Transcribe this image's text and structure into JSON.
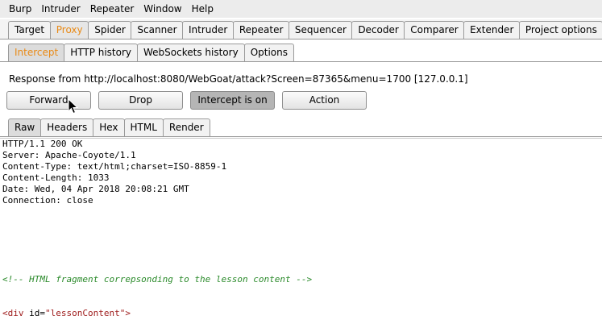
{
  "menubar": [
    "Burp",
    "Intruder",
    "Repeater",
    "Window",
    "Help"
  ],
  "main_tabs": [
    "Target",
    "Proxy",
    "Spider",
    "Scanner",
    "Intruder",
    "Repeater",
    "Sequencer",
    "Decoder",
    "Comparer",
    "Extender",
    "Project options"
  ],
  "main_active": "Proxy",
  "sub_tabs": [
    "Intercept",
    "HTTP history",
    "WebSockets history",
    "Options"
  ],
  "sub_active": "Intercept",
  "response_info": "Response from http://localhost:8080/WebGoat/attack?Screen=87365&menu=1700  [127.0.0.1]",
  "buttons": {
    "forward": "Forward",
    "drop": "Drop",
    "intercept": "Intercept is on",
    "action": "Action"
  },
  "view_tabs": [
    "Raw",
    "Headers",
    "Hex",
    "HTML",
    "Render"
  ],
  "view_active": "Raw",
  "headers": [
    "HTTP/1.1 200 OK",
    "Server: Apache-Coyote/1.1",
    "Content-Type: text/html;charset=ISO-8859-1",
    "Content-Length: 1033",
    "Date: Wed, 04 Apr 2018 20:08:21 GMT",
    "Connection: close"
  ],
  "comment_line": "<!-- HTML fragment correpsonding to the lesson content -->",
  "div_line": {
    "open": "<div",
    "attr": " id=",
    "value": "\"lessonContent\"",
    "close": ">"
  },
  "colors": {
    "active_tab_text": "#e98a16",
    "comment": "#2a8a2a",
    "tag": "#a02020"
  }
}
